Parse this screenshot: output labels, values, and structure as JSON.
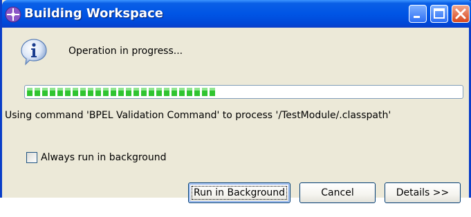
{
  "window": {
    "title": "Building Workspace",
    "controls": {
      "minimize_icon": "minimize-icon",
      "maximize_icon": "maximize-icon",
      "close_icon": "close-icon"
    }
  },
  "message": {
    "icon": "info-icon",
    "text": "Operation in progress..."
  },
  "progress": {
    "fraction": 0.43,
    "color": "#30c430"
  },
  "status_text": "Using command 'BPEL Validation Command' to process '/TestModule/.classpath'",
  "checkbox": {
    "label": "Always run in background",
    "checked": false
  },
  "buttons": {
    "run_in_background": "Run in Background",
    "cancel": "Cancel",
    "details": "Details >>"
  },
  "colors": {
    "titlebar": "#0055e5",
    "dialog_bg": "#ece9d8",
    "border": "#0a3ec8"
  }
}
